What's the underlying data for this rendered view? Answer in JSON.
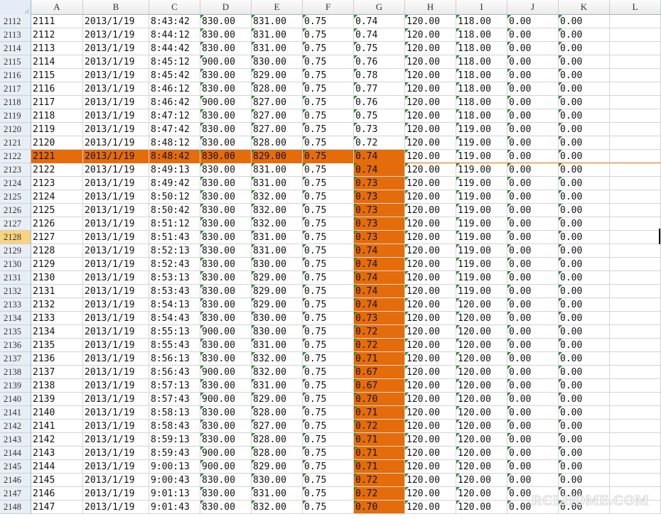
{
  "spreadsheet": {
    "columns": [
      "A",
      "B",
      "C",
      "D",
      "E",
      "F",
      "G",
      "H",
      "I",
      "J",
      "K",
      "L"
    ],
    "active_row": "2128",
    "highlight_row": "2122",
    "highlight_column": "G",
    "highlight_color": "#e46c0a",
    "rows": [
      {
        "num": "2112",
        "cells": [
          "2111",
          "2013/1/19",
          "8:43:42",
          "830.00",
          "831.00",
          "0.75",
          "0.74",
          "120.00",
          "118.00",
          "0.00",
          "0.00"
        ]
      },
      {
        "num": "2113",
        "cells": [
          "2112",
          "2013/1/19",
          "8:44:12",
          "830.00",
          "831.00",
          "0.75",
          "0.74",
          "120.00",
          "118.00",
          "0.00",
          "0.00"
        ]
      },
      {
        "num": "2114",
        "cells": [
          "2113",
          "2013/1/19",
          "8:44:42",
          "830.00",
          "831.00",
          "0.75",
          "0.75",
          "120.00",
          "118.00",
          "0.00",
          "0.00"
        ]
      },
      {
        "num": "2115",
        "cells": [
          "2114",
          "2013/1/19",
          "8:45:12",
          "900.00",
          "830.00",
          "0.75",
          "0.76",
          "120.00",
          "118.00",
          "0.00",
          "0.00"
        ]
      },
      {
        "num": "2116",
        "cells": [
          "2115",
          "2013/1/19",
          "8:45:42",
          "830.00",
          "829.00",
          "0.75",
          "0.78",
          "120.00",
          "118.00",
          "0.00",
          "0.00"
        ]
      },
      {
        "num": "2117",
        "cells": [
          "2116",
          "2013/1/19",
          "8:46:12",
          "830.00",
          "828.00",
          "0.75",
          "0.77",
          "120.00",
          "118.00",
          "0.00",
          "0.00"
        ]
      },
      {
        "num": "2118",
        "cells": [
          "2117",
          "2013/1/19",
          "8:46:42",
          "900.00",
          "827.00",
          "0.75",
          "0.76",
          "120.00",
          "118.00",
          "0.00",
          "0.00"
        ]
      },
      {
        "num": "2119",
        "cells": [
          "2118",
          "2013/1/19",
          "8:47:12",
          "830.00",
          "827.00",
          "0.75",
          "0.75",
          "120.00",
          "118.00",
          "0.00",
          "0.00"
        ]
      },
      {
        "num": "2120",
        "cells": [
          "2119",
          "2013/1/19",
          "8:47:42",
          "830.00",
          "827.00",
          "0.75",
          "0.73",
          "120.00",
          "119.00",
          "0.00",
          "0.00"
        ]
      },
      {
        "num": "2121",
        "cells": [
          "2120",
          "2013/1/19",
          "8:48:12",
          "830.00",
          "828.00",
          "0.75",
          "0.72",
          "120.00",
          "119.00",
          "0.00",
          "0.00"
        ]
      },
      {
        "num": "2122",
        "cells": [
          "2121",
          "2013/1/19",
          "8:48:42",
          "830.00",
          "829.00",
          "0.75",
          "0.74",
          "120.00",
          "119.00",
          "0.00",
          "0.00"
        ]
      },
      {
        "num": "2123",
        "cells": [
          "2122",
          "2013/1/19",
          "8:49:13",
          "830.00",
          "831.00",
          "0.75",
          "0.74",
          "120.00",
          "119.00",
          "0.00",
          "0.00"
        ]
      },
      {
        "num": "2124",
        "cells": [
          "2123",
          "2013/1/19",
          "8:49:42",
          "830.00",
          "831.00",
          "0.75",
          "0.73",
          "120.00",
          "119.00",
          "0.00",
          "0.00"
        ]
      },
      {
        "num": "2125",
        "cells": [
          "2124",
          "2013/1/19",
          "8:50:12",
          "830.00",
          "832.00",
          "0.75",
          "0.73",
          "120.00",
          "119.00",
          "0.00",
          "0.00"
        ]
      },
      {
        "num": "2126",
        "cells": [
          "2125",
          "2013/1/19",
          "8:50:42",
          "830.00",
          "832.00",
          "0.75",
          "0.73",
          "120.00",
          "119.00",
          "0.00",
          "0.00"
        ]
      },
      {
        "num": "2127",
        "cells": [
          "2126",
          "2013/1/19",
          "8:51:12",
          "830.00",
          "832.00",
          "0.75",
          "0.73",
          "120.00",
          "119.00",
          "0.00",
          "0.00"
        ]
      },
      {
        "num": "2128",
        "cells": [
          "2127",
          "2013/1/19",
          "8:51:43",
          "830.00",
          "831.00",
          "0.75",
          "0.73",
          "120.00",
          "119.00",
          "0.00",
          "0.00"
        ]
      },
      {
        "num": "2129",
        "cells": [
          "2128",
          "2013/1/19",
          "8:52:13",
          "830.00",
          "831.00",
          "0.75",
          "0.74",
          "120.00",
          "119.00",
          "0.00",
          "0.00"
        ]
      },
      {
        "num": "2130",
        "cells": [
          "2129",
          "2013/1/19",
          "8:52:43",
          "830.00",
          "830.00",
          "0.75",
          "0.74",
          "120.00",
          "119.00",
          "0.00",
          "0.00"
        ]
      },
      {
        "num": "2131",
        "cells": [
          "2130",
          "2013/1/19",
          "8:53:13",
          "830.00",
          "829.00",
          "0.75",
          "0.74",
          "120.00",
          "119.00",
          "0.00",
          "0.00"
        ]
      },
      {
        "num": "2132",
        "cells": [
          "2131",
          "2013/1/19",
          "8:53:43",
          "830.00",
          "829.00",
          "0.75",
          "0.74",
          "120.00",
          "119.00",
          "0.00",
          "0.00"
        ]
      },
      {
        "num": "2133",
        "cells": [
          "2132",
          "2013/1/19",
          "8:54:13",
          "830.00",
          "829.00",
          "0.75",
          "0.74",
          "120.00",
          "120.00",
          "0.00",
          "0.00"
        ]
      },
      {
        "num": "2134",
        "cells": [
          "2133",
          "2013/1/19",
          "8:54:43",
          "830.00",
          "830.00",
          "0.75",
          "0.73",
          "120.00",
          "120.00",
          "0.00",
          "0.00"
        ]
      },
      {
        "num": "2135",
        "cells": [
          "2134",
          "2013/1/19",
          "8:55:13",
          "900.00",
          "830.00",
          "0.75",
          "0.72",
          "120.00",
          "120.00",
          "0.00",
          "0.00"
        ]
      },
      {
        "num": "2136",
        "cells": [
          "2135",
          "2013/1/19",
          "8:55:43",
          "830.00",
          "831.00",
          "0.75",
          "0.72",
          "120.00",
          "120.00",
          "0.00",
          "0.00"
        ]
      },
      {
        "num": "2137",
        "cells": [
          "2136",
          "2013/1/19",
          "8:56:13",
          "830.00",
          "832.00",
          "0.75",
          "0.71",
          "120.00",
          "120.00",
          "0.00",
          "0.00"
        ]
      },
      {
        "num": "2138",
        "cells": [
          "2137",
          "2013/1/19",
          "8:56:43",
          "900.00",
          "832.00",
          "0.75",
          "0.67",
          "120.00",
          "120.00",
          "0.00",
          "0.00"
        ]
      },
      {
        "num": "2139",
        "cells": [
          "2138",
          "2013/1/19",
          "8:57:13",
          "830.00",
          "831.00",
          "0.75",
          "0.67",
          "120.00",
          "120.00",
          "0.00",
          "0.00"
        ]
      },
      {
        "num": "2140",
        "cells": [
          "2139",
          "2013/1/19",
          "8:57:43",
          "900.00",
          "829.00",
          "0.75",
          "0.70",
          "120.00",
          "120.00",
          "0.00",
          "0.00"
        ]
      },
      {
        "num": "2141",
        "cells": [
          "2140",
          "2013/1/19",
          "8:58:13",
          "830.00",
          "828.00",
          "0.75",
          "0.71",
          "120.00",
          "120.00",
          "0.00",
          "0.00"
        ]
      },
      {
        "num": "2142",
        "cells": [
          "2141",
          "2013/1/19",
          "8:58:43",
          "830.00",
          "827.00",
          "0.75",
          "0.72",
          "120.00",
          "120.00",
          "0.00",
          "0.00"
        ]
      },
      {
        "num": "2143",
        "cells": [
          "2142",
          "2013/1/19",
          "8:59:13",
          "830.00",
          "828.00",
          "0.75",
          "0.71",
          "120.00",
          "120.00",
          "0.00",
          "0.00"
        ]
      },
      {
        "num": "2144",
        "cells": [
          "2143",
          "2013/1/19",
          "8:59:43",
          "900.00",
          "828.00",
          "0.75",
          "0.71",
          "120.00",
          "120.00",
          "0.00",
          "0.00"
        ]
      },
      {
        "num": "2145",
        "cells": [
          "2144",
          "2013/1/19",
          "9:00:13",
          "900.00",
          "829.00",
          "0.75",
          "0.71",
          "120.00",
          "120.00",
          "0.00",
          "0.00"
        ]
      },
      {
        "num": "2146",
        "cells": [
          "2145",
          "2013/1/19",
          "9:00:43",
          "830.00",
          "830.00",
          "0.75",
          "0.72",
          "120.00",
          "120.00",
          "0.00",
          "0.00"
        ]
      },
      {
        "num": "2147",
        "cells": [
          "2146",
          "2013/1/19",
          "9:01:13",
          "830.00",
          "831.00",
          "0.75",
          "0.72",
          "120.00",
          "120.00",
          "0.00",
          "0.00"
        ]
      },
      {
        "num": "2148",
        "cells": [
          "2147",
          "2013/1/19",
          "9:01:43",
          "830.00",
          "832.00",
          "0.75",
          "0.70",
          "120.00",
          "120.00",
          "0.00",
          "0.00"
        ]
      }
    ]
  },
  "watermark": "RCLHOME.COM"
}
